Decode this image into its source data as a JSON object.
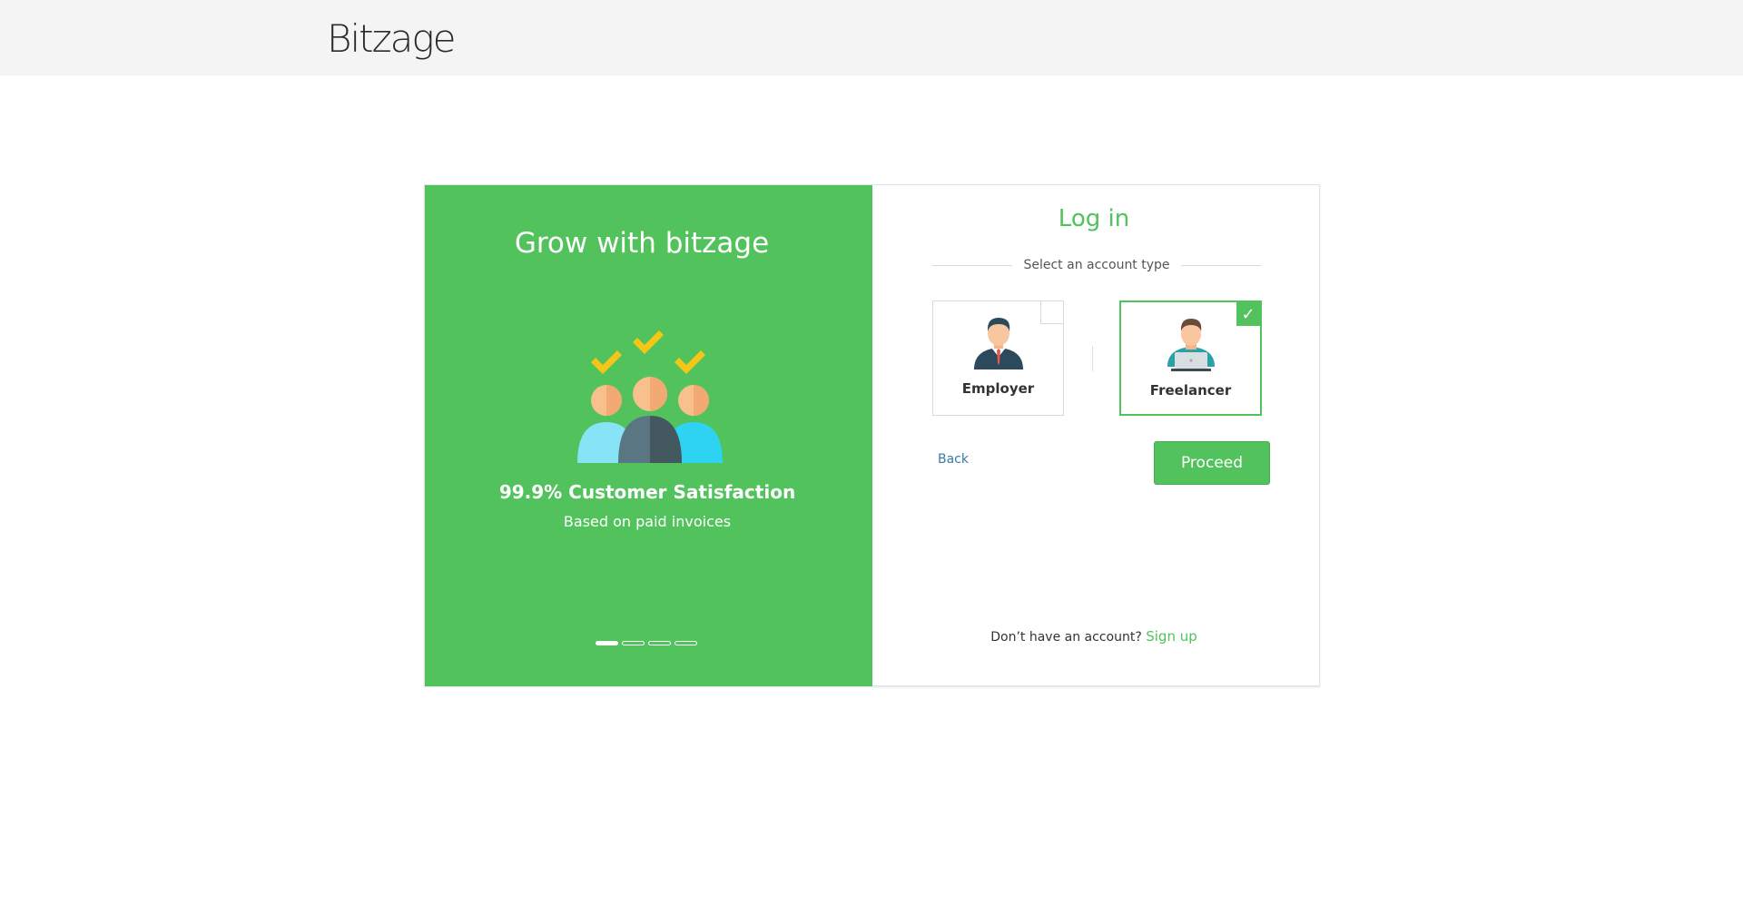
{
  "header": {
    "logo_text": "Bitzage"
  },
  "promo": {
    "title": "Grow with bitzage",
    "headline": "99.9% Customer Satisfaction",
    "subtext": "Based on paid invoices",
    "slides": {
      "count": 4,
      "active_index": 0
    },
    "illustration": "three-people-with-checkmarks"
  },
  "login": {
    "title": "Log in",
    "select_label": "Select an account type",
    "account_types": [
      {
        "label": "Employer",
        "icon": "employer-icon",
        "selected": false
      },
      {
        "label": "Freelancer",
        "icon": "freelancer-icon",
        "selected": true
      }
    ],
    "back_label": "Back",
    "proceed_label": "Proceed",
    "no_account_text": "Don’t have an account?",
    "signup_label": "Sign up"
  },
  "colors": {
    "brand_green": "#52c35c",
    "link_blue": "#3a7aa8",
    "topbar_bg": "#f4f4f4"
  }
}
